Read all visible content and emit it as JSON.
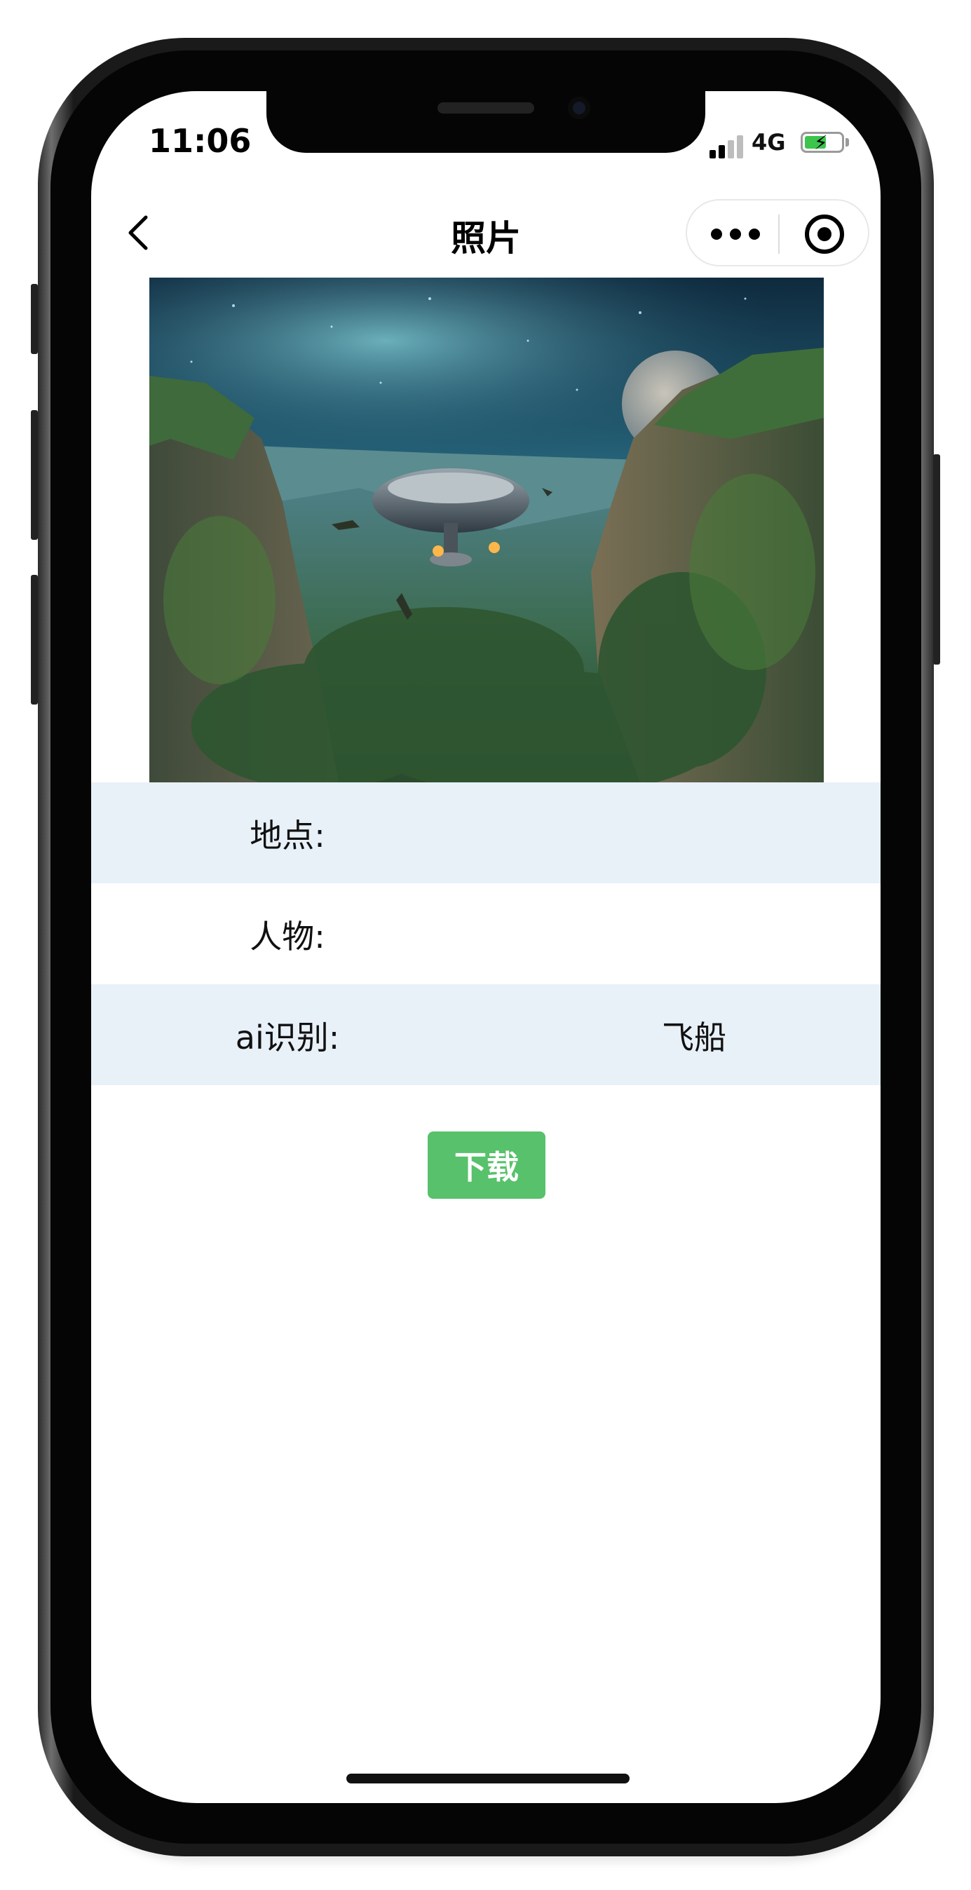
{
  "status_bar": {
    "time": "11:06",
    "network": "4G"
  },
  "nav": {
    "title": "照片"
  },
  "photo": {
    "description_icon": "ufo-canyon-photo"
  },
  "info": [
    {
      "label": "地点:",
      "value": "",
      "bg": "#e8f0f8"
    },
    {
      "label": "人物:",
      "value": "",
      "bg": "#ffffff"
    },
    {
      "label": "ai识别:",
      "value": "飞船",
      "bg": "#e8f0f8"
    }
  ],
  "actions": {
    "download_label": "下载"
  },
  "colors": {
    "accent": "#58c16b",
    "row_alt": "#e8f0f8"
  }
}
